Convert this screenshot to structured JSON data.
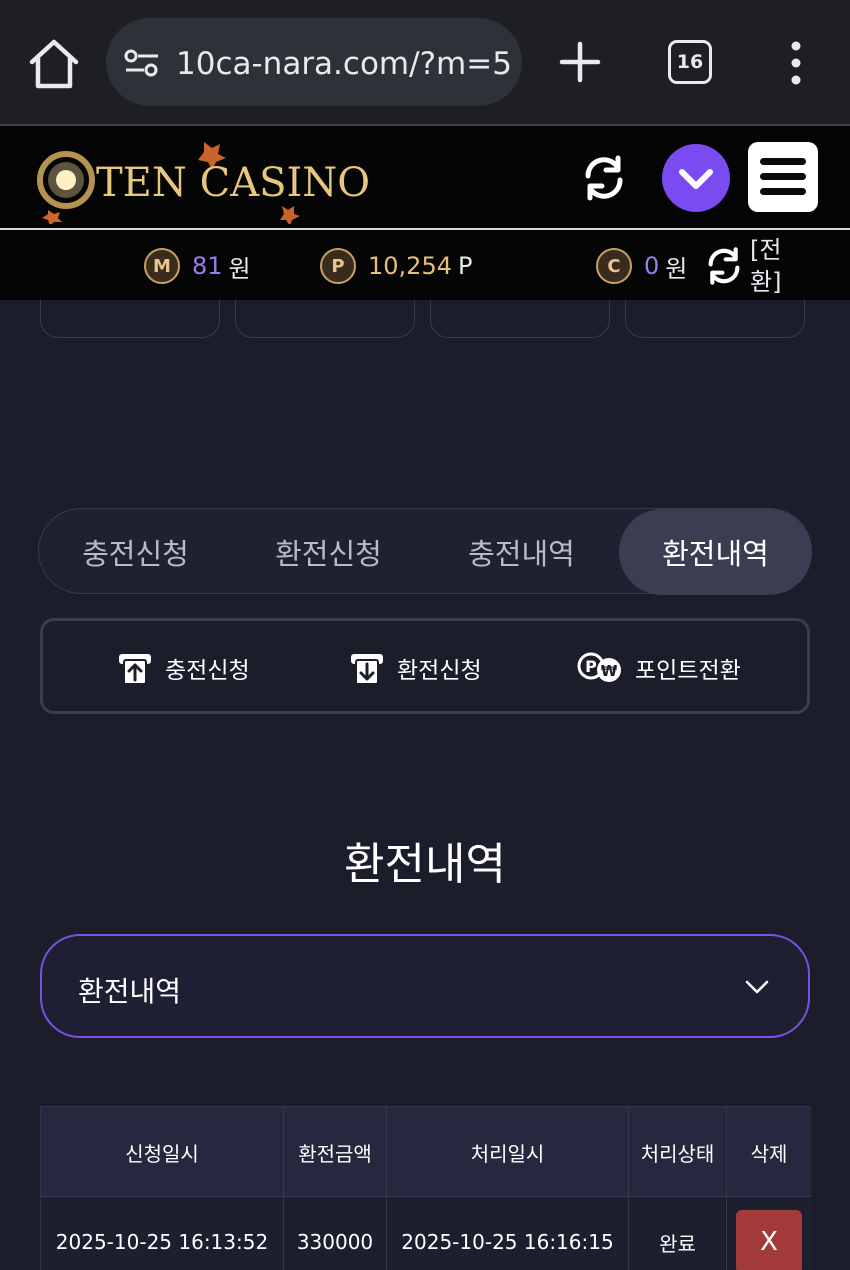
{
  "browser": {
    "url": "10ca-nara.com/?m=5",
    "tab_count": "16"
  },
  "header": {
    "logo_text": "TEN CASINO"
  },
  "balances": {
    "m_icon": "M",
    "m_value": "81",
    "m_unit": "원",
    "p_icon": "P",
    "p_value": "10,254",
    "p_unit": "P",
    "c_icon": "C",
    "c_value": "0",
    "c_unit": "원",
    "convert_label": "[전환]"
  },
  "tabs": [
    {
      "label": "충전신청"
    },
    {
      "label": "환전신청"
    },
    {
      "label": "충전내역"
    },
    {
      "label": "환전내역",
      "active": true
    }
  ],
  "actions": [
    {
      "label": "충전신청",
      "icon": "deposit-icon"
    },
    {
      "label": "환전신청",
      "icon": "withdraw-icon"
    },
    {
      "label": "포인트전환",
      "icon": "point-convert-icon"
    }
  ],
  "page_title": "환전내역",
  "select": {
    "value": "환전내역"
  },
  "table": {
    "headers": [
      "신청일시",
      "환전금액",
      "처리일시",
      "처리상태",
      "삭제"
    ],
    "rows": [
      [
        "2025-10-25 16:13:52",
        "330000",
        "2025-10-25 16:16:15",
        "완료",
        "X"
      ]
    ]
  },
  "colors": {
    "accent": "#7b4bf2",
    "gold": "#e8c074",
    "delete": "#a23a3a"
  }
}
